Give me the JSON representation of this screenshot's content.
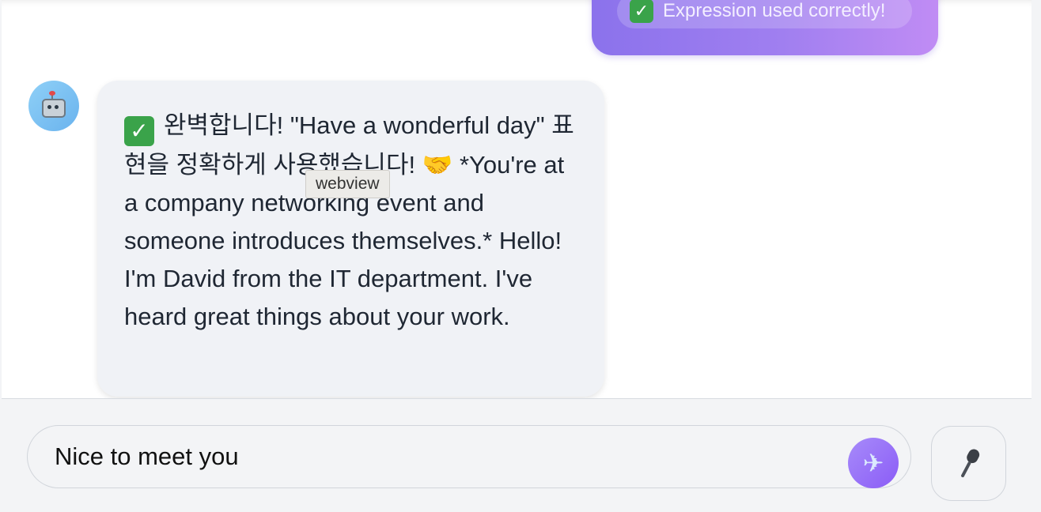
{
  "user_message": {
    "feedback": {
      "icon": "check-icon",
      "text": "Expression used correctly!"
    }
  },
  "bot_message": {
    "avatar_icon": "robot-icon",
    "check_icon": "check-icon",
    "text_1": "완벽합니다! \"Have a wonderful day\" 표현을 정확하게 사용했습니다!",
    "handshake": "🤝",
    "text_2": "*You're at a company networking event and someone introduces themselves.* Hello! I'm David from the IT department. I've heard great things about your work."
  },
  "tooltip": "webview",
  "composer": {
    "input_value": "Nice to meet you",
    "send_icon": "airplane-icon",
    "mic_icon": "microphone-icon"
  }
}
